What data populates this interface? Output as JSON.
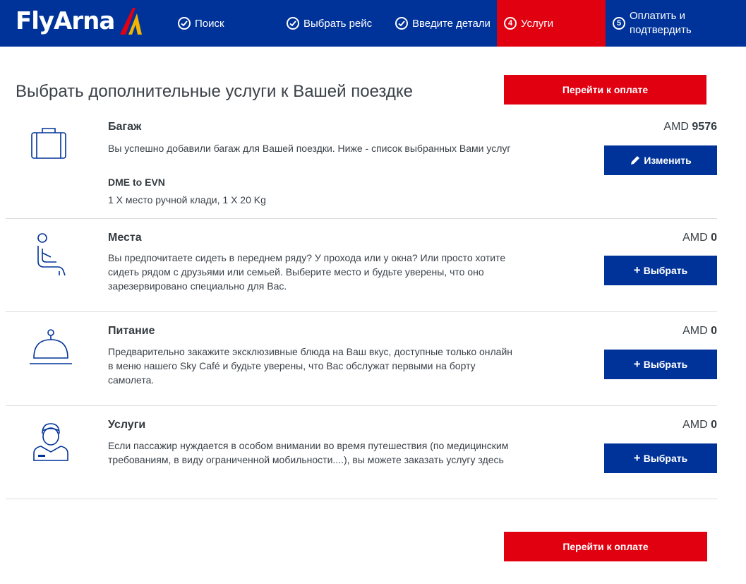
{
  "brand": {
    "name": "FlyArna",
    "colors": {
      "primary": "#003399",
      "accent": "#e10010",
      "logo_yellow": "#f4b400"
    }
  },
  "steps": [
    {
      "label": "Поиск",
      "state": "done",
      "icon": "check-circle-icon"
    },
    {
      "label": "Выбрать рейс",
      "state": "done",
      "icon": "check-circle-icon"
    },
    {
      "label": "Введите детали",
      "state": "done",
      "icon": "check-circle-icon"
    },
    {
      "label": "Услуги",
      "state": "active",
      "number": "4"
    },
    {
      "label": "Оплатить и подтвердить",
      "state": "pending",
      "number": "5"
    }
  ],
  "page": {
    "title": "Выбрать дополнительные услуги к Вашей поездке",
    "pay_label": "Перейти к оплате"
  },
  "services": [
    {
      "name": "Багаж",
      "icon": "suitcase-icon",
      "description": "Вы успешно добавили багаж для Вашей поездки. Ниже - список выбранных Вами услуг",
      "route": "DME to EVN",
      "details": "1 X место ручной клади, 1 X 20 Kg",
      "currency": "AMD",
      "amount": "9576",
      "button": "Изменить",
      "button_icon": "pencil-icon"
    },
    {
      "name": "Места",
      "icon": "seat-icon",
      "description": "Вы предпочитаете сидеть в переднем ряду? У прохода или у окна? Или просто хотите сидеть рядом с друзьями или семьей. Выберите место и будьте уверены, что оно зарезервировано специально для Вас.",
      "currency": "AMD",
      "amount": "0",
      "button": "Выбрать",
      "button_icon": "plus-icon"
    },
    {
      "name": "Питание",
      "icon": "cloche-icon",
      "description": "Предварительно закажите эксклюзивные блюда на Ваш вкус, доступные только онлайн в меню нашего Sky Café и будьте уверены, что Вас обслужат первыми на борту самолета.",
      "currency": "AMD",
      "amount": "0",
      "button": "Выбрать",
      "button_icon": "plus-icon"
    },
    {
      "name": "Услуги",
      "icon": "flight-attendant-icon",
      "description": "Если пассажир нуждается в особом внимании во время путешествия (по медицинским требованиям, в виду ограниченной мобильности....), вы можете заказать услугу здесь",
      "currency": "AMD",
      "amount": "0",
      "button": "Выбрать",
      "button_icon": "plus-icon"
    }
  ]
}
